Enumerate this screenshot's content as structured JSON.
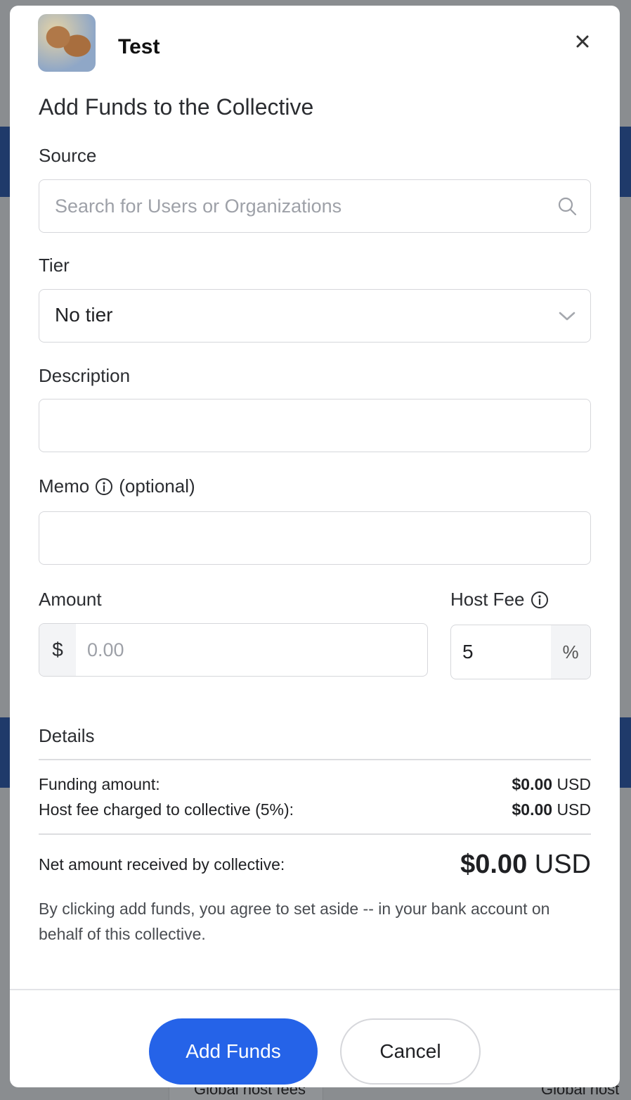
{
  "background": {
    "snippets": [
      "Global host fees",
      "Global host"
    ]
  },
  "modal": {
    "collective_name": "Test",
    "title": "Add Funds to the Collective",
    "source": {
      "label": "Source",
      "placeholder": "Search for Users or Organizations"
    },
    "tier": {
      "label": "Tier",
      "value": "No tier"
    },
    "description": {
      "label": "Description",
      "value": ""
    },
    "memo": {
      "label": "Memo",
      "optional": "(optional)",
      "value": ""
    },
    "amount": {
      "label": "Amount",
      "currency_symbol": "$",
      "placeholder": "0.00"
    },
    "host_fee": {
      "label": "Host Fee",
      "value": "5",
      "suffix": "%"
    },
    "details": {
      "heading": "Details",
      "funding_amount_label": "Funding amount:",
      "funding_amount_value": "$0.00",
      "funding_amount_currency": "USD",
      "host_fee_label": "Host fee charged to collective (5%):",
      "host_fee_value": "$0.00",
      "host_fee_currency": "USD",
      "net_label": "Net amount received by collective:",
      "net_value": "$0.00",
      "net_currency": "USD"
    },
    "disclaimer": "By clicking add funds, you agree to set aside -- in your bank account on behalf of this collective.",
    "buttons": {
      "add_funds": "Add Funds",
      "cancel": "Cancel"
    }
  },
  "colors": {
    "primary": "#2563e8",
    "border": "#d6d7db"
  }
}
